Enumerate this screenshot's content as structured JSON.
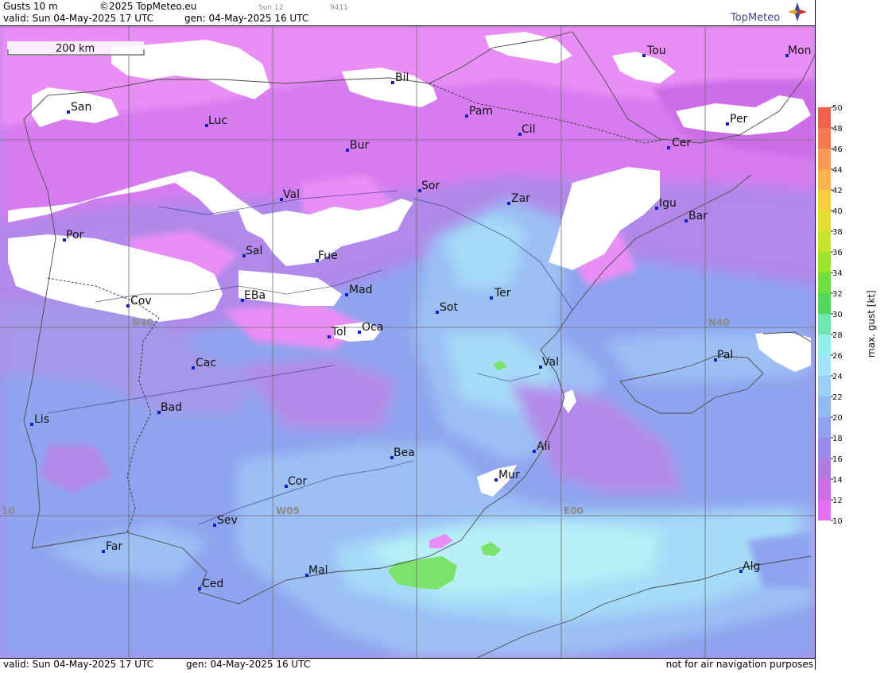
{
  "header": {
    "product": "Gusts 10 m",
    "copyright": "©2025 TopMeteo.eu",
    "run_small": "Sun 12",
    "id_small": "9411",
    "valid": "valid:  Sun  04-May-2025  17 UTC",
    "gen": "gen: 04-May-2025 16 UTC",
    "brand": "TopMeteo"
  },
  "footer": {
    "valid": "valid:  Sun  04-May-2025  17 UTC",
    "gen": "gen: 04-May-2025 16 UTC",
    "disclaimer": "not for air navigation purposes"
  },
  "scale_bar": {
    "label": "200 km"
  },
  "grid_labels": {
    "n40_west": "N40",
    "n40_east": "N40",
    "w05": "W05",
    "e00": "E00",
    "w10": "10"
  },
  "cities": [
    {
      "id": "tou",
      "name": "Tou"
    },
    {
      "id": "mon",
      "name": "Mon"
    },
    {
      "id": "bil",
      "name": "Bil"
    },
    {
      "id": "san",
      "name": "San"
    },
    {
      "id": "luc",
      "name": "Luc"
    },
    {
      "id": "pam",
      "name": "Pam"
    },
    {
      "id": "per",
      "name": "Per"
    },
    {
      "id": "cil",
      "name": "Cil"
    },
    {
      "id": "cer",
      "name": "Cer"
    },
    {
      "id": "bur",
      "name": "Bur"
    },
    {
      "id": "sor",
      "name": "Sor"
    },
    {
      "id": "zar",
      "name": "Zar"
    },
    {
      "id": "val1",
      "name": "Val"
    },
    {
      "id": "igu",
      "name": "Igu"
    },
    {
      "id": "bar",
      "name": "Bar"
    },
    {
      "id": "por",
      "name": "Por"
    },
    {
      "id": "sal",
      "name": "Sal"
    },
    {
      "id": "fue",
      "name": "Fue"
    },
    {
      "id": "mad",
      "name": "Mad"
    },
    {
      "id": "ter",
      "name": "Ter"
    },
    {
      "id": "cov",
      "name": "Cov"
    },
    {
      "id": "eba",
      "name": "EBa"
    },
    {
      "id": "sot",
      "name": "Sot"
    },
    {
      "id": "tol",
      "name": "Tol"
    },
    {
      "id": "oca",
      "name": "Oca"
    },
    {
      "id": "cac",
      "name": "Cac"
    },
    {
      "id": "val2",
      "name": "Val"
    },
    {
      "id": "pal",
      "name": "Pal"
    },
    {
      "id": "bad",
      "name": "Bad"
    },
    {
      "id": "lis",
      "name": "Lis"
    },
    {
      "id": "ali",
      "name": "Ali"
    },
    {
      "id": "bea",
      "name": "Bea"
    },
    {
      "id": "mur",
      "name": "Mur"
    },
    {
      "id": "cor",
      "name": "Cor"
    },
    {
      "id": "sev",
      "name": "Sev"
    },
    {
      "id": "far",
      "name": "Far"
    },
    {
      "id": "mal",
      "name": "Mal"
    },
    {
      "id": "alg",
      "name": "Alg"
    },
    {
      "id": "ced",
      "name": "Ced"
    }
  ],
  "legend": {
    "title": "max. gust  [kt]",
    "ticks": [
      "50",
      "48",
      "46",
      "44",
      "42",
      "40",
      "38",
      "36",
      "34",
      "32",
      "30",
      "28",
      "26",
      "24",
      "22",
      "20",
      "18",
      "16",
      "14",
      "12",
      "10"
    ],
    "colors": [
      "#f0604a",
      "#f57a52",
      "#f89a56",
      "#fbb24f",
      "#f7cd3e",
      "#e4dd33",
      "#c6e42e",
      "#9de42f",
      "#6fdf3a",
      "#52d95c",
      "#6ee7b0",
      "#92f0ec",
      "#a3e4fb",
      "#9acff8",
      "#92b9f2",
      "#8ea2ed",
      "#9a8ce8",
      "#b07ae3",
      "#cc6ce6",
      "#e46ef1"
    ]
  },
  "colors": {
    "white_calm": "#ffffff",
    "lt_magenta": "#e98ef5",
    "magenta": "#d77bf0",
    "violet": "#b38ae9",
    "blue": "#8ea4ef",
    "lt_blue": "#9cc0f4",
    "cyan": "#a6dcf8",
    "lt_cyan": "#b6f0f6",
    "green": "#7be36b",
    "city_marker": "#1020c8"
  }
}
